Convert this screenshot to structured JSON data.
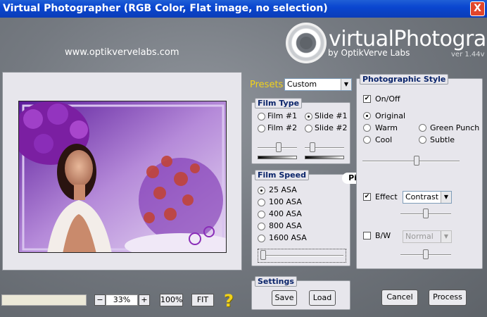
{
  "window": {
    "title": "Virtual Photographer (RGB Color, Flat image, no selection)",
    "close": "X"
  },
  "header": {
    "url": "www.optikvervelabs.com",
    "logo_main": "virtualPhotographer",
    "logo_sub": "by OptikVerve Labs",
    "version": "ver 1.44v"
  },
  "presets": {
    "label": "Presets",
    "value": "Custom"
  },
  "film_type": {
    "title": "Film Type",
    "options": [
      "Film #1",
      "Slide #1",
      "Film #2",
      "Slide #2"
    ],
    "selected": "Slide #1",
    "slider1_level": 0.55,
    "slider2_level": 0.15
  },
  "film_speed": {
    "title": "Film Speed",
    "options": [
      "25 ASA",
      "100 ASA",
      "400 ASA",
      "800 ASA",
      "1600 ASA"
    ],
    "selected": "25 ASA",
    "slider_level": 0.0
  },
  "watermark_label": "Pinuccia",
  "settings": {
    "title": "Settings",
    "save": "Save",
    "load": "Load"
  },
  "style": {
    "title": "Photographic Style",
    "onoff_label": "On/Off",
    "onoff_checked": true,
    "options": [
      "Original",
      "Warm",
      "Green Punch",
      "Cool",
      "Subtle"
    ],
    "selected": "Original",
    "slider_level": 0.5,
    "effect_label": "Effect",
    "effect_checked": true,
    "effect_value": "Contrast",
    "effect_slider_level": 0.5,
    "bw_label": "B/W",
    "bw_checked": false,
    "bw_value": "Normal",
    "bw_slider_level": 0.5
  },
  "zoom": {
    "minus": "−",
    "value": "33%",
    "plus": "+",
    "hundred": "100%",
    "fit": "FIT",
    "help": "?"
  },
  "buttons": {
    "cancel": "Cancel",
    "process": "Process"
  },
  "colors": {
    "title_bar": "#0a46d0",
    "panel_bg": "#e7e6ec",
    "accent_yellow": "#f2d21a",
    "bg": "#747980"
  }
}
